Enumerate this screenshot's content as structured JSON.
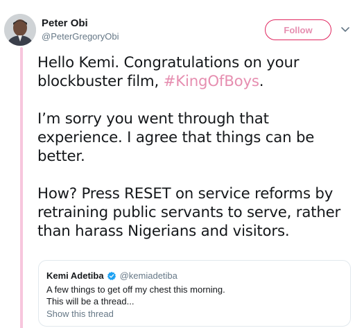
{
  "author": {
    "display_name": "Peter Obi",
    "handle": "@PeterGregoryObi"
  },
  "follow_button": {
    "label": "Follow"
  },
  "icons": {
    "avatar": "profile-photo",
    "more": "chevron-down-icon",
    "verified": "verified-badge-icon"
  },
  "tweet": {
    "para1_prefix": "Hello Kemi. Congratulations on your blockbuster film, ",
    "para1_hashtag": "#KingOfBoys",
    "para1_suffix": ".",
    "para2": "I’m sorry you went through that experience. I agree that things can be better.",
    "para3": "How? Press RESET on service reforms by retraining public servants to serve, rather than harass Nigerians and visitors."
  },
  "quoted_tweet": {
    "display_name": "Kemi Adetiba",
    "handle": "@kemiadetiba",
    "line1": "A few things to get off my chest this morning.",
    "line2": "This will be a thread...",
    "show_thread": "Show this thread"
  },
  "colors": {
    "accent": "#e0245e",
    "hashtag": "#e68eb0",
    "thread_line": "#f7c6dd",
    "verified": "#1da1f2",
    "secondary_text": "#657786"
  }
}
